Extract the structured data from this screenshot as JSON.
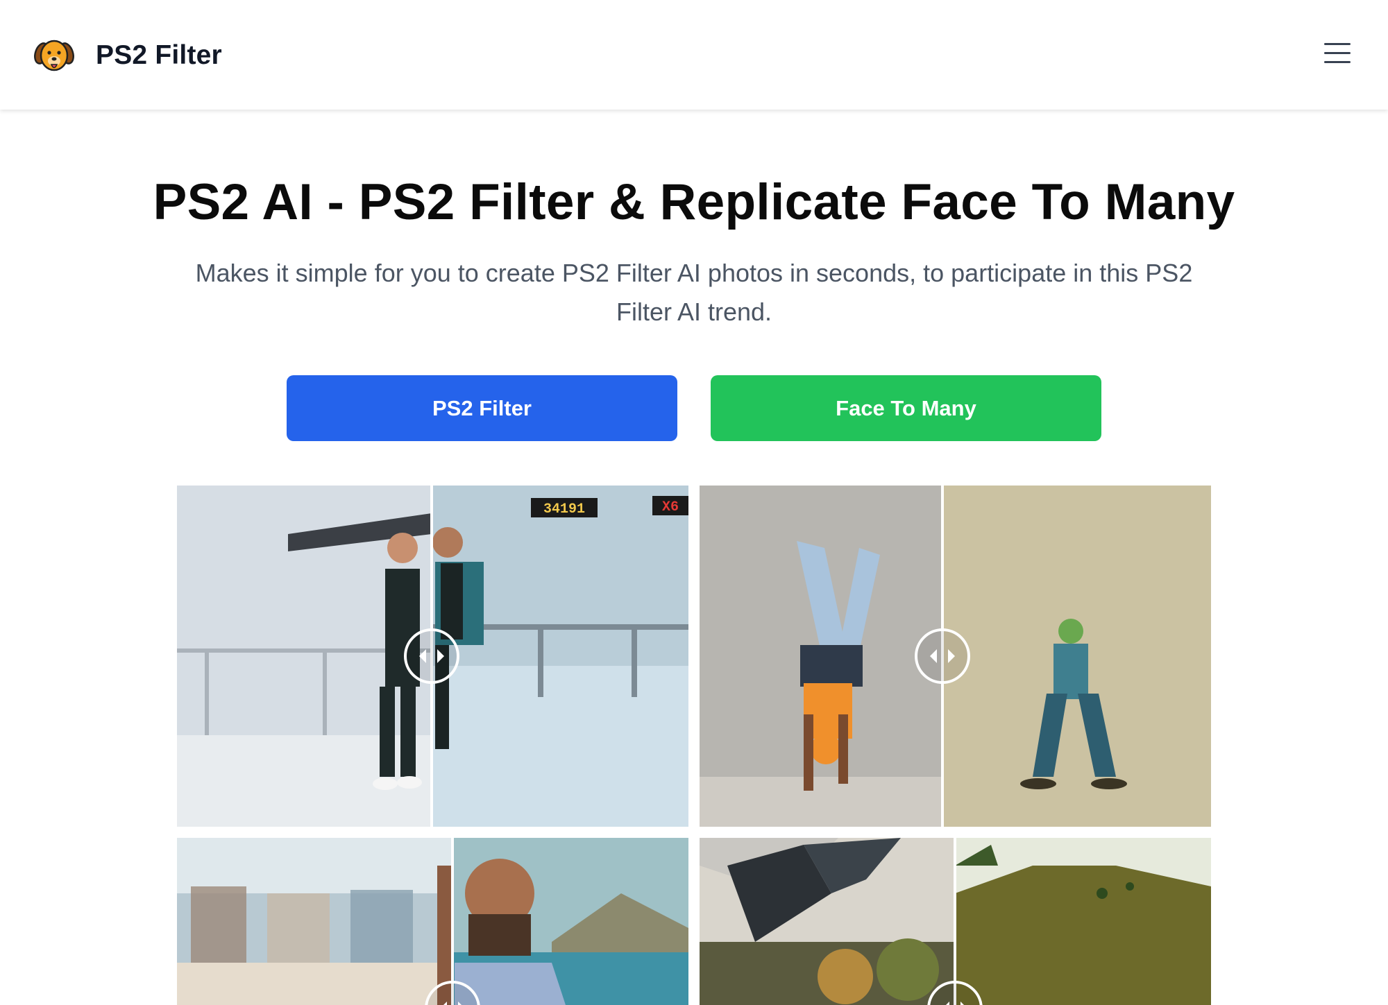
{
  "header": {
    "logo_icon": "dog-face-icon",
    "brand": "PS2 Filter",
    "menu_icon": "hamburger-menu-icon"
  },
  "hero": {
    "title": "PS2 AI - PS2 Filter & Replicate Face To Many",
    "subtitle": "Makes it simple for you to create PS2 Filter AI photos in seconds, to participate in this PS2 Filter AI trend."
  },
  "buttons": {
    "primary": {
      "label": "PS2 Filter",
      "color": "#2563eb"
    },
    "secondary": {
      "label": "Face To Many",
      "color": "#22c35a"
    }
  },
  "gallery": {
    "handle_icon": "left-right-arrows-icon",
    "items": [
      {
        "name": "man-leaning-on-railing",
        "before": "Original photo",
        "after": "PS2 style render",
        "hud_score": "34191",
        "hud_multiplier": "X6"
      },
      {
        "name": "woman-handstand",
        "before": "Original photo",
        "after": "PS2 style render"
      },
      {
        "name": "bearded-man-beach",
        "before": "Original photo",
        "after": "PS2 style render"
      },
      {
        "name": "car-on-hill",
        "before": "Original photo",
        "after": "PS2 style render"
      }
    ]
  }
}
